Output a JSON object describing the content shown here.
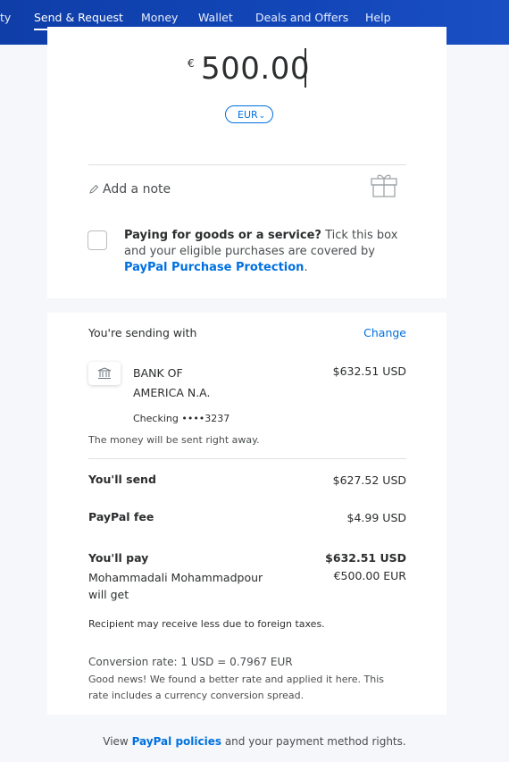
{
  "nav": {
    "items": [
      "ty",
      "Send & Request",
      "Money",
      "Wallet",
      "Deals and Offers",
      "Help"
    ],
    "active_index": 1
  },
  "amount": {
    "currency_symbol": "€",
    "value": "500.00",
    "currency_code": "EUR"
  },
  "note": {
    "placeholder": "Add a note",
    "icon": "pencil-icon",
    "gift_icon": "gift-icon"
  },
  "goods": {
    "bold": "Paying for goods or a service?",
    "text": " Tick this box and your eligible purchases are covered by ",
    "link": "PayPal Purchase Protection",
    "end": "."
  },
  "funding": {
    "label": "You're sending with",
    "change": "Change",
    "bank_name": "BANK OF AMERICA N.A.",
    "bank_line1": "BANK OF",
    "bank_line2": "AMERICA N.A.",
    "bank_amount": "$632.51 USD",
    "account": "Checking ••••3237",
    "timing": "The money will be sent right away."
  },
  "summary": {
    "send_label": "You'll send",
    "send_value": "$627.52 USD",
    "fee_label": "PayPal fee",
    "fee_value": "$4.99 USD",
    "pay_label": "You'll pay",
    "pay_value": "$632.51 USD",
    "recipient_label": "Mohammadali Mohammadpour",
    "recipient_label2": "will get",
    "recipient_value": "€500.00 EUR",
    "tax_note": "Recipient may receive less due to foreign taxes.",
    "rate": "Conversion rate: 1 USD = 0.7967 EUR",
    "rate_note": "Good news! We found a better rate and applied it here. This rate includes a currency conversion spread."
  },
  "footer": {
    "prefix": "View ",
    "link": "PayPal policies",
    "suffix": " and your payment method rights."
  },
  "colors": {
    "nav_bg": "#1246b8",
    "link": "#0070e0",
    "page_bg": "#f5f7fa"
  }
}
